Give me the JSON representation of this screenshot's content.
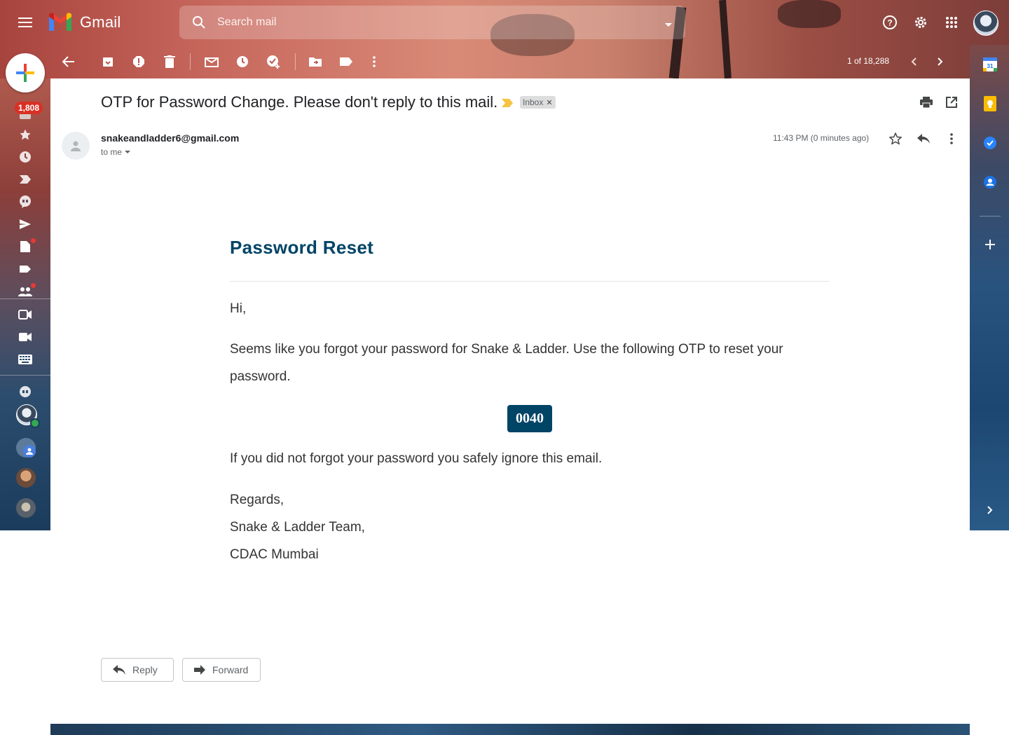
{
  "app": {
    "name": "Gmail",
    "search_placeholder": "Search mail"
  },
  "toolbar": {
    "pagination": "1 of 18,288"
  },
  "left_rail": {
    "unread_badge": "1,808"
  },
  "email": {
    "subject": "OTP for Password Change. Please don't reply to this mail.",
    "label": "Inbox",
    "sender": "snakeandladder6@gmail.com",
    "recipient": "to me",
    "time": "11:43 PM (0 minutes ago)",
    "body": {
      "heading": "Password Reset",
      "greeting": "Hi,",
      "line1": "Seems like you forgot your password for Snake & Ladder. Use the following OTP to reset your",
      "line2": "password.",
      "otp": "0040",
      "line3": "If you did not forgot your password you safely ignore this email.",
      "sign1": "Regards,",
      "sign2": "Snake & Ladder Team,",
      "sign3": "CDAC Mumbai"
    }
  },
  "actions": {
    "reply": "Reply",
    "forward": "Forward"
  },
  "colors": {
    "accent": "#004466",
    "badge": "#d93025",
    "important": "#f6c343"
  }
}
